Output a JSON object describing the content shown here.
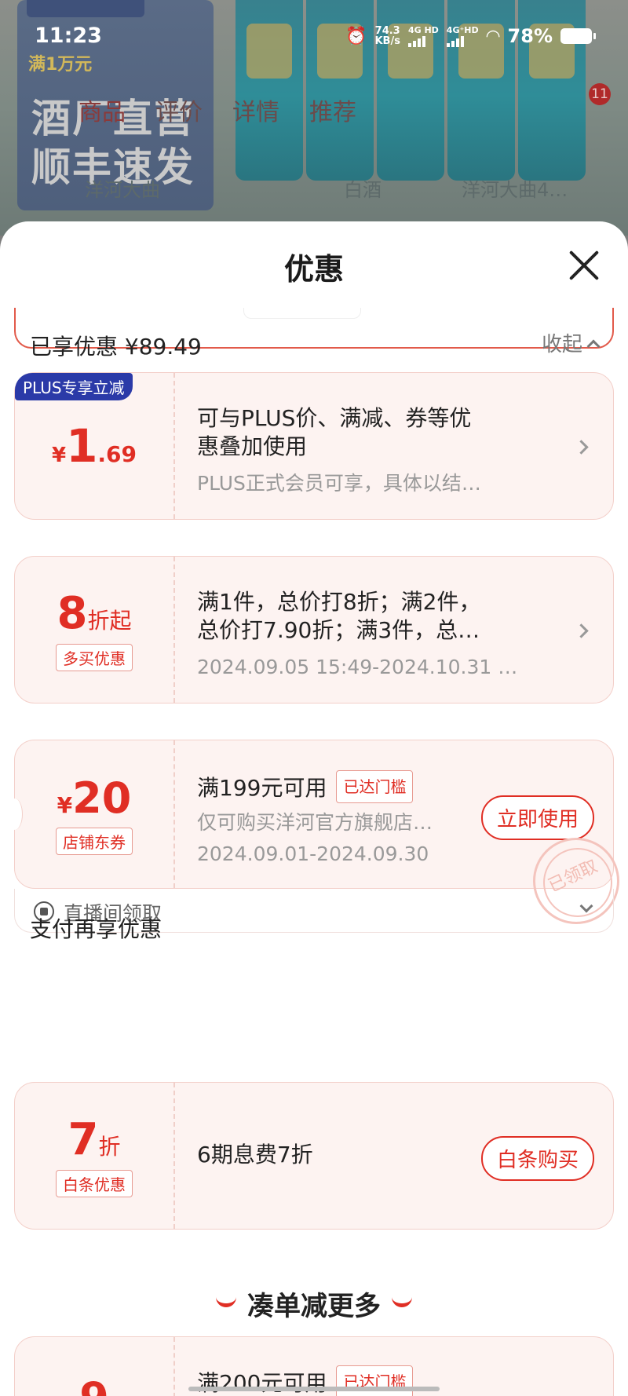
{
  "status_bar": {
    "time": "11:23",
    "speed_value": "74.3",
    "speed_unit": "KB/s",
    "net1": "4G HD",
    "net2": "4G⁺HD",
    "battery": "78%"
  },
  "background": {
    "promo_amount": "满1万元",
    "promo_big_line1": "酒厂直营",
    "promo_big_line2": "顺丰速发",
    "tabs": [
      "商品",
      "评价",
      "详情",
      "推荐"
    ],
    "cart_badge": "11",
    "categories": [
      "洋河大曲",
      "白酒",
      "洋河大曲4…"
    ]
  },
  "sheet": {
    "title": "优惠",
    "enjoyed_label": "已享优惠 ¥89.49",
    "collapse_label": "收起",
    "pay_section_label": "支付再享优惠",
    "more_label": "凑单减更多"
  },
  "coupons": [
    {
      "tag": "PLUS专享立减",
      "currency": "¥",
      "amount_int": "1",
      "amount_dec": ".69",
      "line1": "可与PLUS价、满减、券等优",
      "line2": "惠叠加使用",
      "line3": "PLUS正式会员可享，具体以结…"
    },
    {
      "discount": "8",
      "discount_unit": "折起",
      "tag": "多买优惠",
      "line1": "满1件，总价打8折；满2件，",
      "line2": "总价打7.90折；满3件，总…",
      "line3": "2024.09.05 15:49-2024.10.31 …"
    },
    {
      "currency": "¥",
      "amount": "20",
      "tag": "店铺东券",
      "line1": "满199元可用",
      "threshold": "已达门槛",
      "line2": "仅可购买洋河官方旗舰店…",
      "line3": "2024.09.01-2024.09.30",
      "button": "立即使用",
      "stamp": "已领取",
      "footer": "直播间领取"
    }
  ],
  "pay_coupon": {
    "discount": "7",
    "discount_unit": "折",
    "tag": "白条优惠",
    "line1": "6期息费7折",
    "button": "白条购买"
  },
  "more_coupon": {
    "amount_partial": "9",
    "line1": "满200元可用",
    "threshold": "已达门槛"
  },
  "colors": {
    "accent": "#e02e24",
    "card_bg": "#fdf3f1",
    "plus_tag": "#2b3aa8"
  }
}
